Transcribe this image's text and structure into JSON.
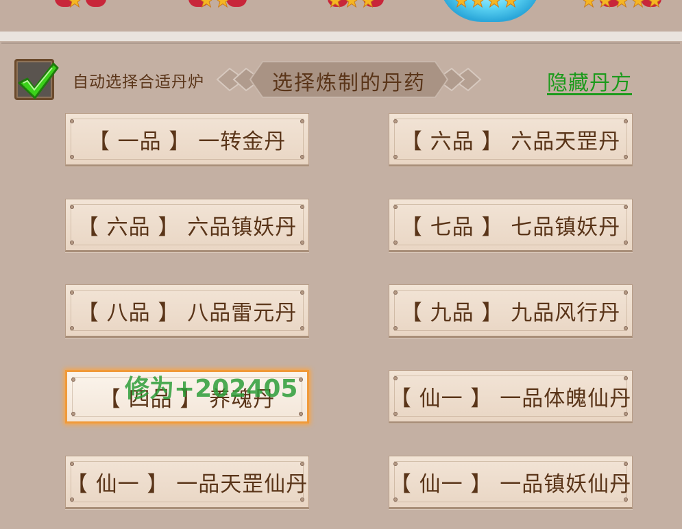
{
  "header": {
    "auto_select_label": "自动选择合适丹炉",
    "auto_select_checked": true,
    "title": "选择炼制的丹药",
    "hide_recipes_label": "隐藏丹方"
  },
  "recipes": [
    {
      "label": "【 一品 】 一转金丹",
      "selected": false
    },
    {
      "label": "【 六品 】 六品天罡丹",
      "selected": false
    },
    {
      "label": "【 六品 】 六品镇妖丹",
      "selected": false
    },
    {
      "label": "【 七品 】 七品镇妖丹",
      "selected": false
    },
    {
      "label": "【 八品 】 八品雷元丹",
      "selected": false
    },
    {
      "label": "【 九品 】 九品风行丹",
      "selected": false
    },
    {
      "label": "【 四品 】 养魂丹",
      "selected": true
    },
    {
      "label": "【 仙一 】 一品体魄仙丹",
      "selected": false
    },
    {
      "label": "【 仙一 】 一品天罡仙丹",
      "selected": false
    },
    {
      "label": "【 仙一 】 一品镇妖仙丹",
      "selected": false
    }
  ],
  "watermark": "修为+202405",
  "colors": {
    "text_brown": "#5a3519",
    "link_green": "#1b9a1b",
    "selected_glow": "#f09a3a",
    "background": "#c4b0a3"
  }
}
